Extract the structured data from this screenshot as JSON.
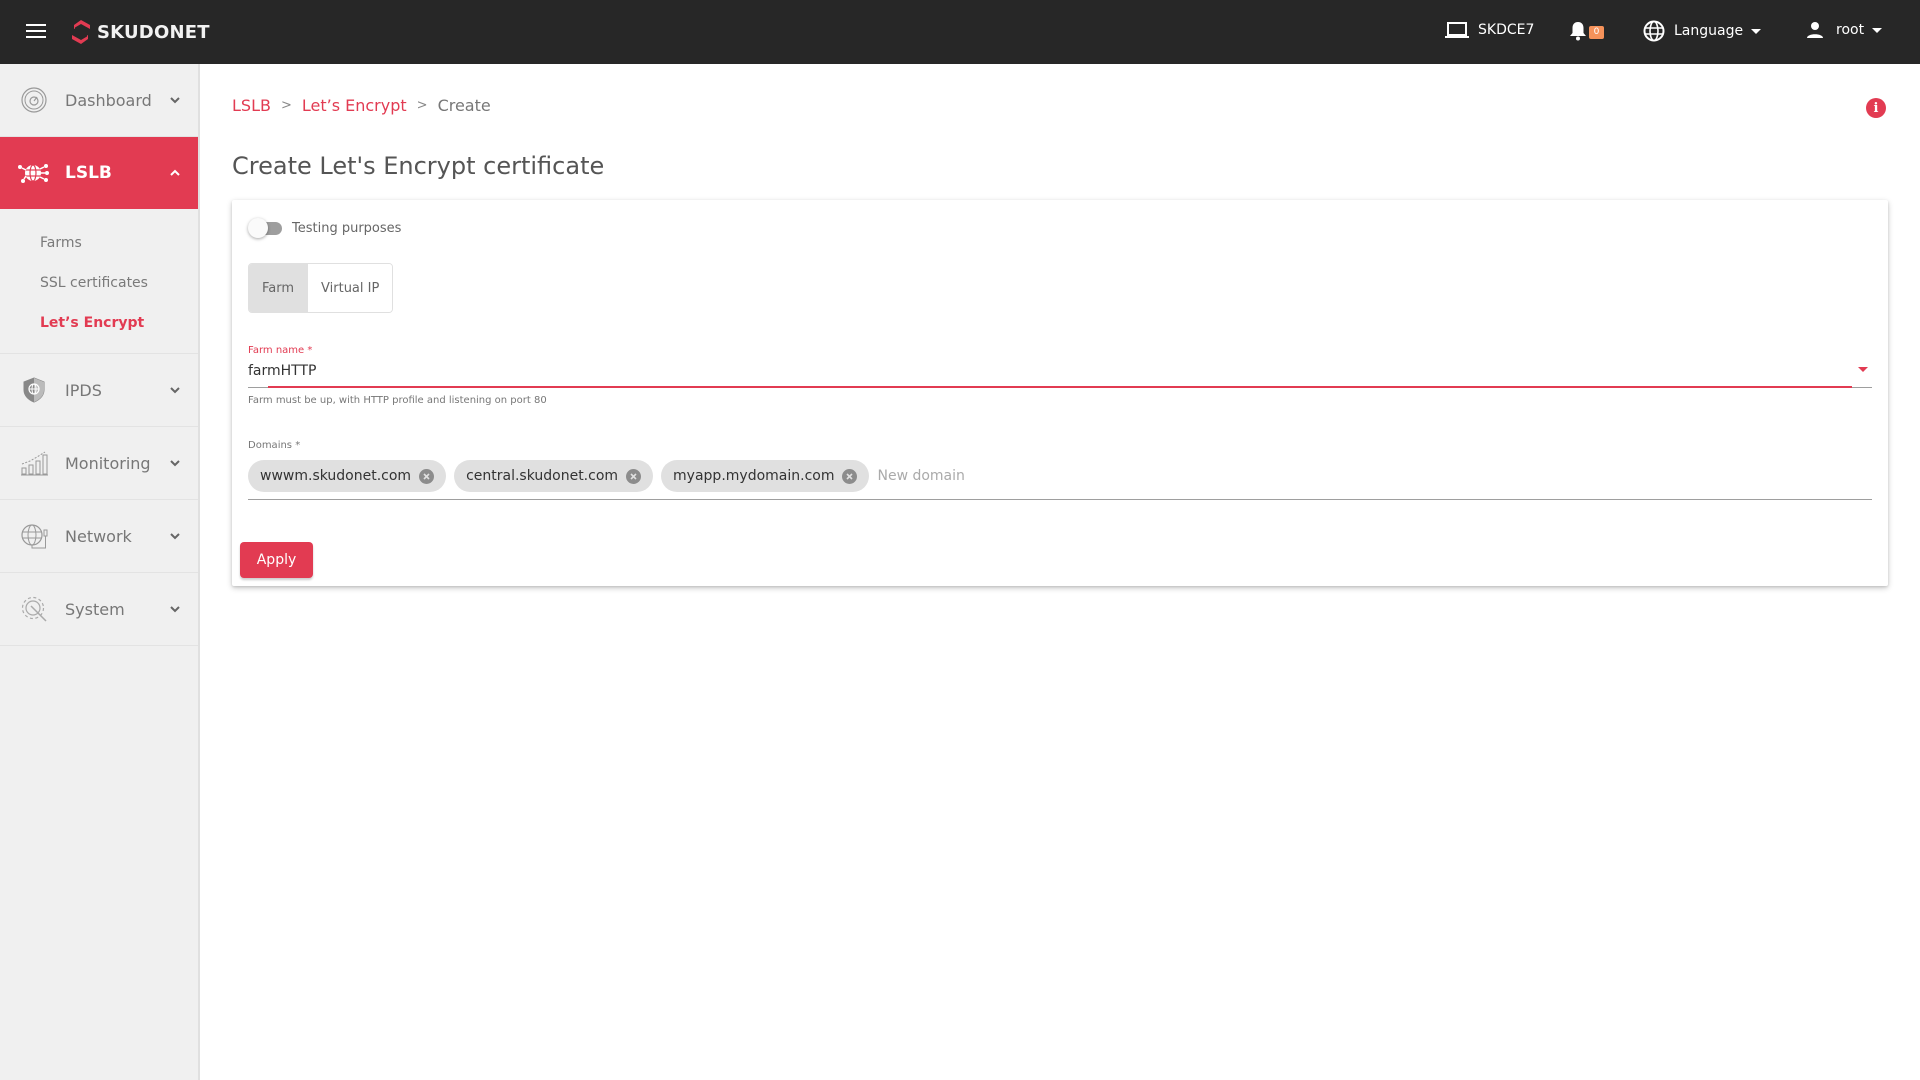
{
  "topbar": {
    "brand": "SKUDONET",
    "device": "SKDCE7",
    "notifications_count": "0",
    "language_label": "Language",
    "user_label": "root",
    "colors": {
      "background": "#272727",
      "badge": "#f6925a"
    }
  },
  "sidebar": {
    "items": [
      {
        "label": "Dashboard",
        "icon": "dashboard-gauge-icon",
        "expanded": false
      },
      {
        "label": "LSLB",
        "icon": "lslb-globe-network-icon",
        "expanded": true,
        "active": true,
        "children": [
          {
            "label": "Farms"
          },
          {
            "label": "SSL certificates"
          },
          {
            "label": "Let’s Encrypt",
            "active": true
          }
        ]
      },
      {
        "label": "IPDS",
        "icon": "shield-globe-icon",
        "expanded": false
      },
      {
        "label": "Monitoring",
        "icon": "bar-chart-icon",
        "expanded": false
      },
      {
        "label": "Network",
        "icon": "network-globe-icon",
        "expanded": false
      },
      {
        "label": "System",
        "icon": "gear-wrench-icon",
        "expanded": false
      }
    ]
  },
  "breadcrumb": {
    "items": [
      "LSLB",
      "Let’s Encrypt",
      "Create"
    ],
    "separator": ">"
  },
  "page": {
    "title": "Create Let's Encrypt certificate",
    "accent_color": "#e23b52"
  },
  "form": {
    "testing_toggle": {
      "label": "Testing purposes",
      "on": false
    },
    "target_type": {
      "options": [
        "Farm",
        "Virtual IP"
      ],
      "selected": "Farm"
    },
    "farm_name": {
      "label": "Farm name *",
      "value": "farmHTTP",
      "hint": "Farm must be up, with HTTP profile and listening on port 80"
    },
    "domains": {
      "label": "Domains *",
      "chips": [
        "wwwm.skudonet.com",
        "central.skudonet.com",
        "myapp.mydomain.com"
      ],
      "placeholder": "New domain",
      "value": ""
    },
    "apply_label": "Apply"
  }
}
